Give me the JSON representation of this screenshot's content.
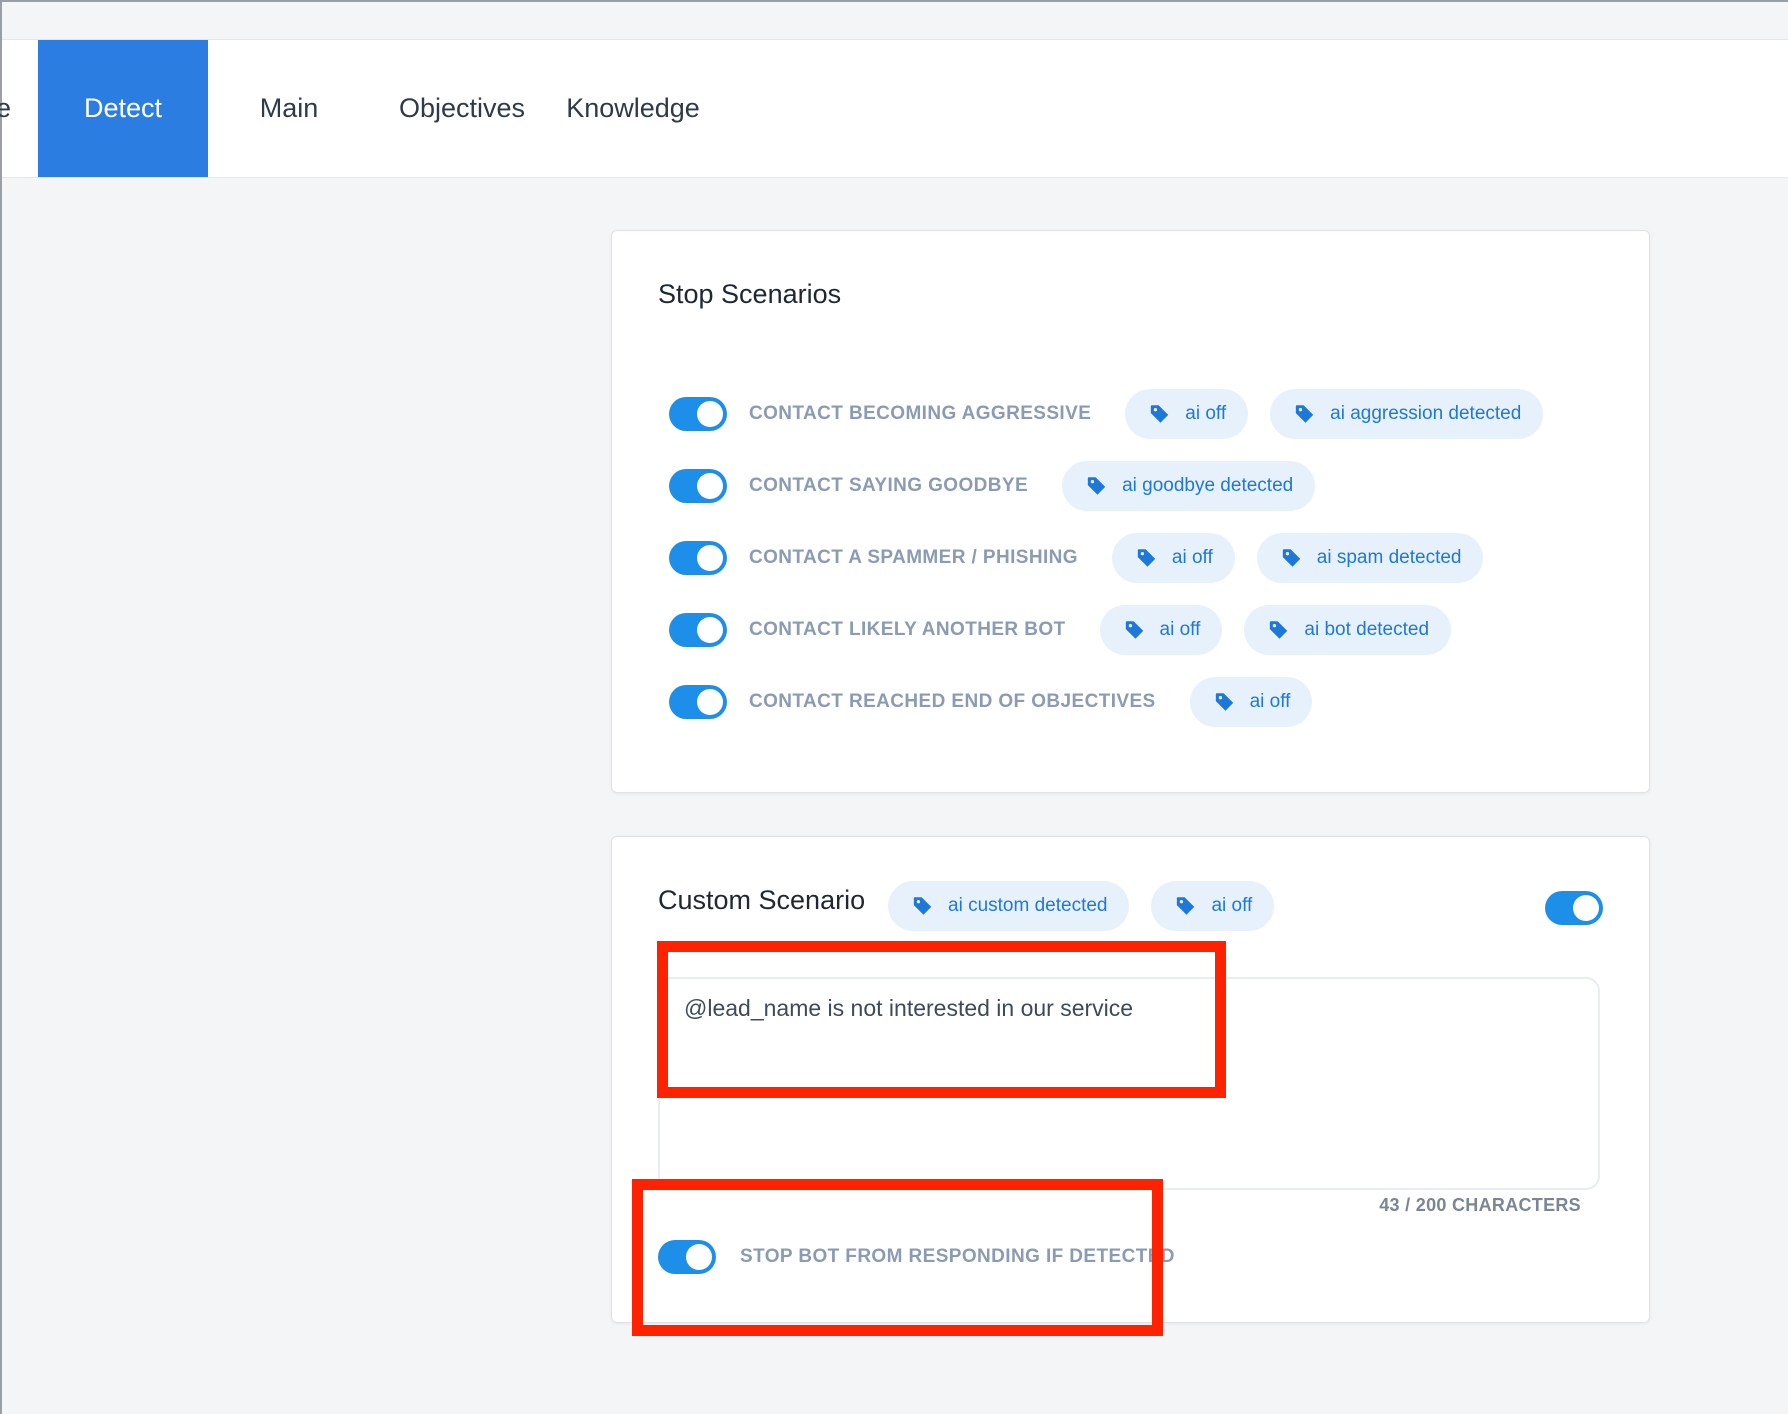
{
  "tabs": {
    "cut_label": "e",
    "items": [
      {
        "label": "Detect",
        "active": true
      },
      {
        "label": "Main"
      },
      {
        "label": "Objectives"
      },
      {
        "label": "Knowledge"
      }
    ]
  },
  "stop_scenarios": {
    "title": "Stop Scenarios",
    "rows": [
      {
        "label": "CONTACT BECOMING AGGRESSIVE",
        "enabled": true,
        "tags": [
          "ai off",
          "ai aggression detected"
        ]
      },
      {
        "label": "CONTACT SAYING GOODBYE",
        "enabled": true,
        "tags": [
          "ai goodbye detected"
        ]
      },
      {
        "label": "CONTACT A SPAMMER / PHISHING",
        "enabled": true,
        "tags": [
          "ai off",
          "ai spam detected"
        ]
      },
      {
        "label": "CONTACT LIKELY ANOTHER BOT",
        "enabled": true,
        "tags": [
          "ai off",
          "ai bot detected"
        ]
      },
      {
        "label": "CONTACT REACHED END OF OBJECTIVES",
        "enabled": true,
        "tags": [
          "ai off"
        ]
      }
    ]
  },
  "custom_scenario": {
    "title": "Custom Scenario",
    "tags": [
      "ai custom detected",
      "ai off"
    ],
    "enabled": true,
    "text": "@lead_name is not interested in our service",
    "counter": "43 / 200 CHARACTERS",
    "stop_bot_label": "STOP BOT FROM RESPONDING IF DETECTED",
    "stop_bot_enabled": true
  },
  "colors": {
    "accent": "#2b7de1",
    "toggle_on": "#1e8fe8",
    "chip_bg": "#e7f1fc",
    "chip_text": "#1e78d7",
    "annotation": "#ff2200"
  },
  "icons": {
    "tag": "tag-icon"
  }
}
